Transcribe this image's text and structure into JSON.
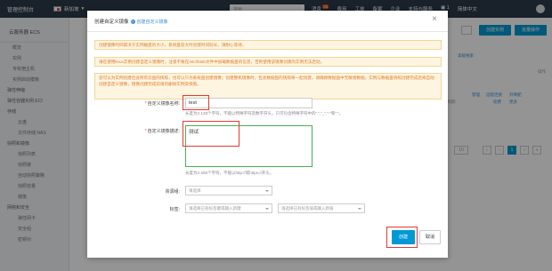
{
  "topbar": {
    "brand": "管理控制台",
    "region": "新加坡",
    "search_placeholder": "搜索",
    "nav": [
      {
        "label": "消息",
        "badge": "33"
      },
      {
        "label": "费用"
      },
      {
        "label": "工单"
      },
      {
        "label": "备案"
      },
      {
        "label": "企业"
      },
      {
        "label": "支持与服务"
      },
      {
        "label": "1"
      },
      {
        "label": "简体中文"
      }
    ]
  },
  "sidebar": {
    "title": "云服务器 ECS",
    "items": [
      {
        "label": "概览",
        "level": "item"
      },
      {
        "label": "实例",
        "level": "item"
      },
      {
        "label": "专有宿主机",
        "level": "item"
      },
      {
        "label": "实例启动模板",
        "level": "item"
      },
      {
        "label": "弹性伸缩",
        "level": "grp"
      },
      {
        "label": "弹性容器实例 ECI",
        "level": "grp"
      },
      {
        "label": "存储",
        "level": "grp"
      },
      {
        "label": "云盘",
        "level": "l2"
      },
      {
        "label": "文件存储 NAS",
        "level": "l2"
      },
      {
        "label": "快照和镜像",
        "level": "grp"
      },
      {
        "label": "快照列表",
        "level": "l2"
      },
      {
        "label": "快照链",
        "level": "l2"
      },
      {
        "label": "自动快照策略",
        "level": "l2"
      },
      {
        "label": "快照容量",
        "level": "l2"
      },
      {
        "label": "镜像",
        "level": "l2"
      },
      {
        "label": "网络和安全",
        "level": "grp"
      },
      {
        "label": "弹性网卡",
        "level": "l2"
      },
      {
        "label": "安全组",
        "level": "l2"
      },
      {
        "label": "密钥对",
        "level": "l2"
      }
    ]
  },
  "background": {
    "create_instance": "创建实例",
    "batch_ops": "批量操作",
    "advanced_search": "高级搜索",
    "col_ops": "操作",
    "manage": "管理",
    "remote_connect": "远程连接",
    "more": "更多",
    "upgrade": "升降配",
    "renew": "续费",
    "time": "00:00 到期",
    "page_size": "10",
    "page": "1"
  },
  "modal": {
    "title": "创建自定义镜像",
    "help_link": "创建自定义镜像",
    "notices": [
      "创建镜像时间取决于实例磁盘的大小，系统盘较大时创建时间较长，请耐心等待。",
      "请在使用linux实例创建自定义镜像时，注意不要在/etc/fstab文件中加载数据盘的信息，否则使用该镜像创建的实例无法启动。",
      "您可以为实例创建包含所有云盘的快照，也可以只为系统盘创建镜像；创建整机镜像时，包含数据盘的快照将一起创建，请确保数据盘中无敏感数据。实例与数据盘快照创建完成后将自动创建自定义镜像，镜像创建完成前请勿删除实例及快照。"
    ],
    "name_label": "自定义镜像名称:",
    "name_value": "test",
    "name_hint": "长度为2-128个字符，不能以特殊字符及数字开头，只可包含特殊字符中的\".\",\"_\",\"-\"和\":\"。",
    "desc_label": "自定义镜像描述:",
    "desc_value": "测试",
    "desc_hint": "长度为2-256个字符，不能以http://或https://开头。",
    "resource_group_label": "资源组:",
    "resource_group_placeholder": "请选择",
    "tags_label": "标签:",
    "tag_key_placeholder": "请选择已有标签键或输入新键",
    "tag_value_placeholder": "请选择已有标签值或输入新值",
    "create_label": "创建",
    "cancel_label": "取消"
  },
  "colors": {
    "topbar_bg": "#2c3a49",
    "accent": "#0099d4",
    "notice_text": "#e07a2a",
    "highlight_red": "#e53935",
    "highlight_green": "#4caf50"
  }
}
